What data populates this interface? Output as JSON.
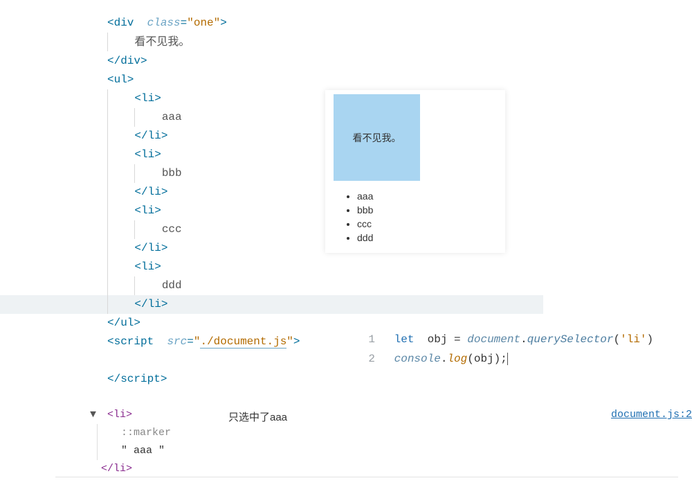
{
  "code": {
    "div_open_1": "<div",
    "div_attr": "class",
    "div_val": "\"one\"",
    "div_open_2": ">",
    "div_text": "看不见我。",
    "div_close": "</div>",
    "ul_open": "<ul>",
    "li_open": "<li>",
    "li_close": "</li>",
    "ul_close": "</ul>",
    "li1": "aaa",
    "li2": "bbb",
    "li3": "ccc",
    "li4": "ddd",
    "script_open_1": "<script",
    "script_attr": "src",
    "script_val": "\"",
    "script_path": "./document.js",
    "script_val_end": "\"",
    "script_open_2": ">",
    "script_close_text": "script",
    "angle_close_slash": "</",
    "angle_close": ">"
  },
  "preview": {
    "box_text": "看不见我。",
    "items": [
      "aaa",
      "bbb",
      "ccc",
      "ddd"
    ]
  },
  "js": {
    "ln1": "1",
    "ln2": "2",
    "let": "let",
    "obj": "obj",
    "eq": " = ",
    "doc": "document",
    "dot": ".",
    "qs": "querySelector",
    "open_p": "(",
    "arg": "'li'",
    "close_p": ")",
    "semi": ";",
    "console": "console",
    "log": "log",
    "obj2": "(obj)",
    "semi2": ";"
  },
  "console": {
    "li_open": "<li>",
    "marker": "::marker",
    "content": "\" aaa \"",
    "li_close": "</li>",
    "note": "只选中了aaa",
    "source": "document.js:2"
  }
}
